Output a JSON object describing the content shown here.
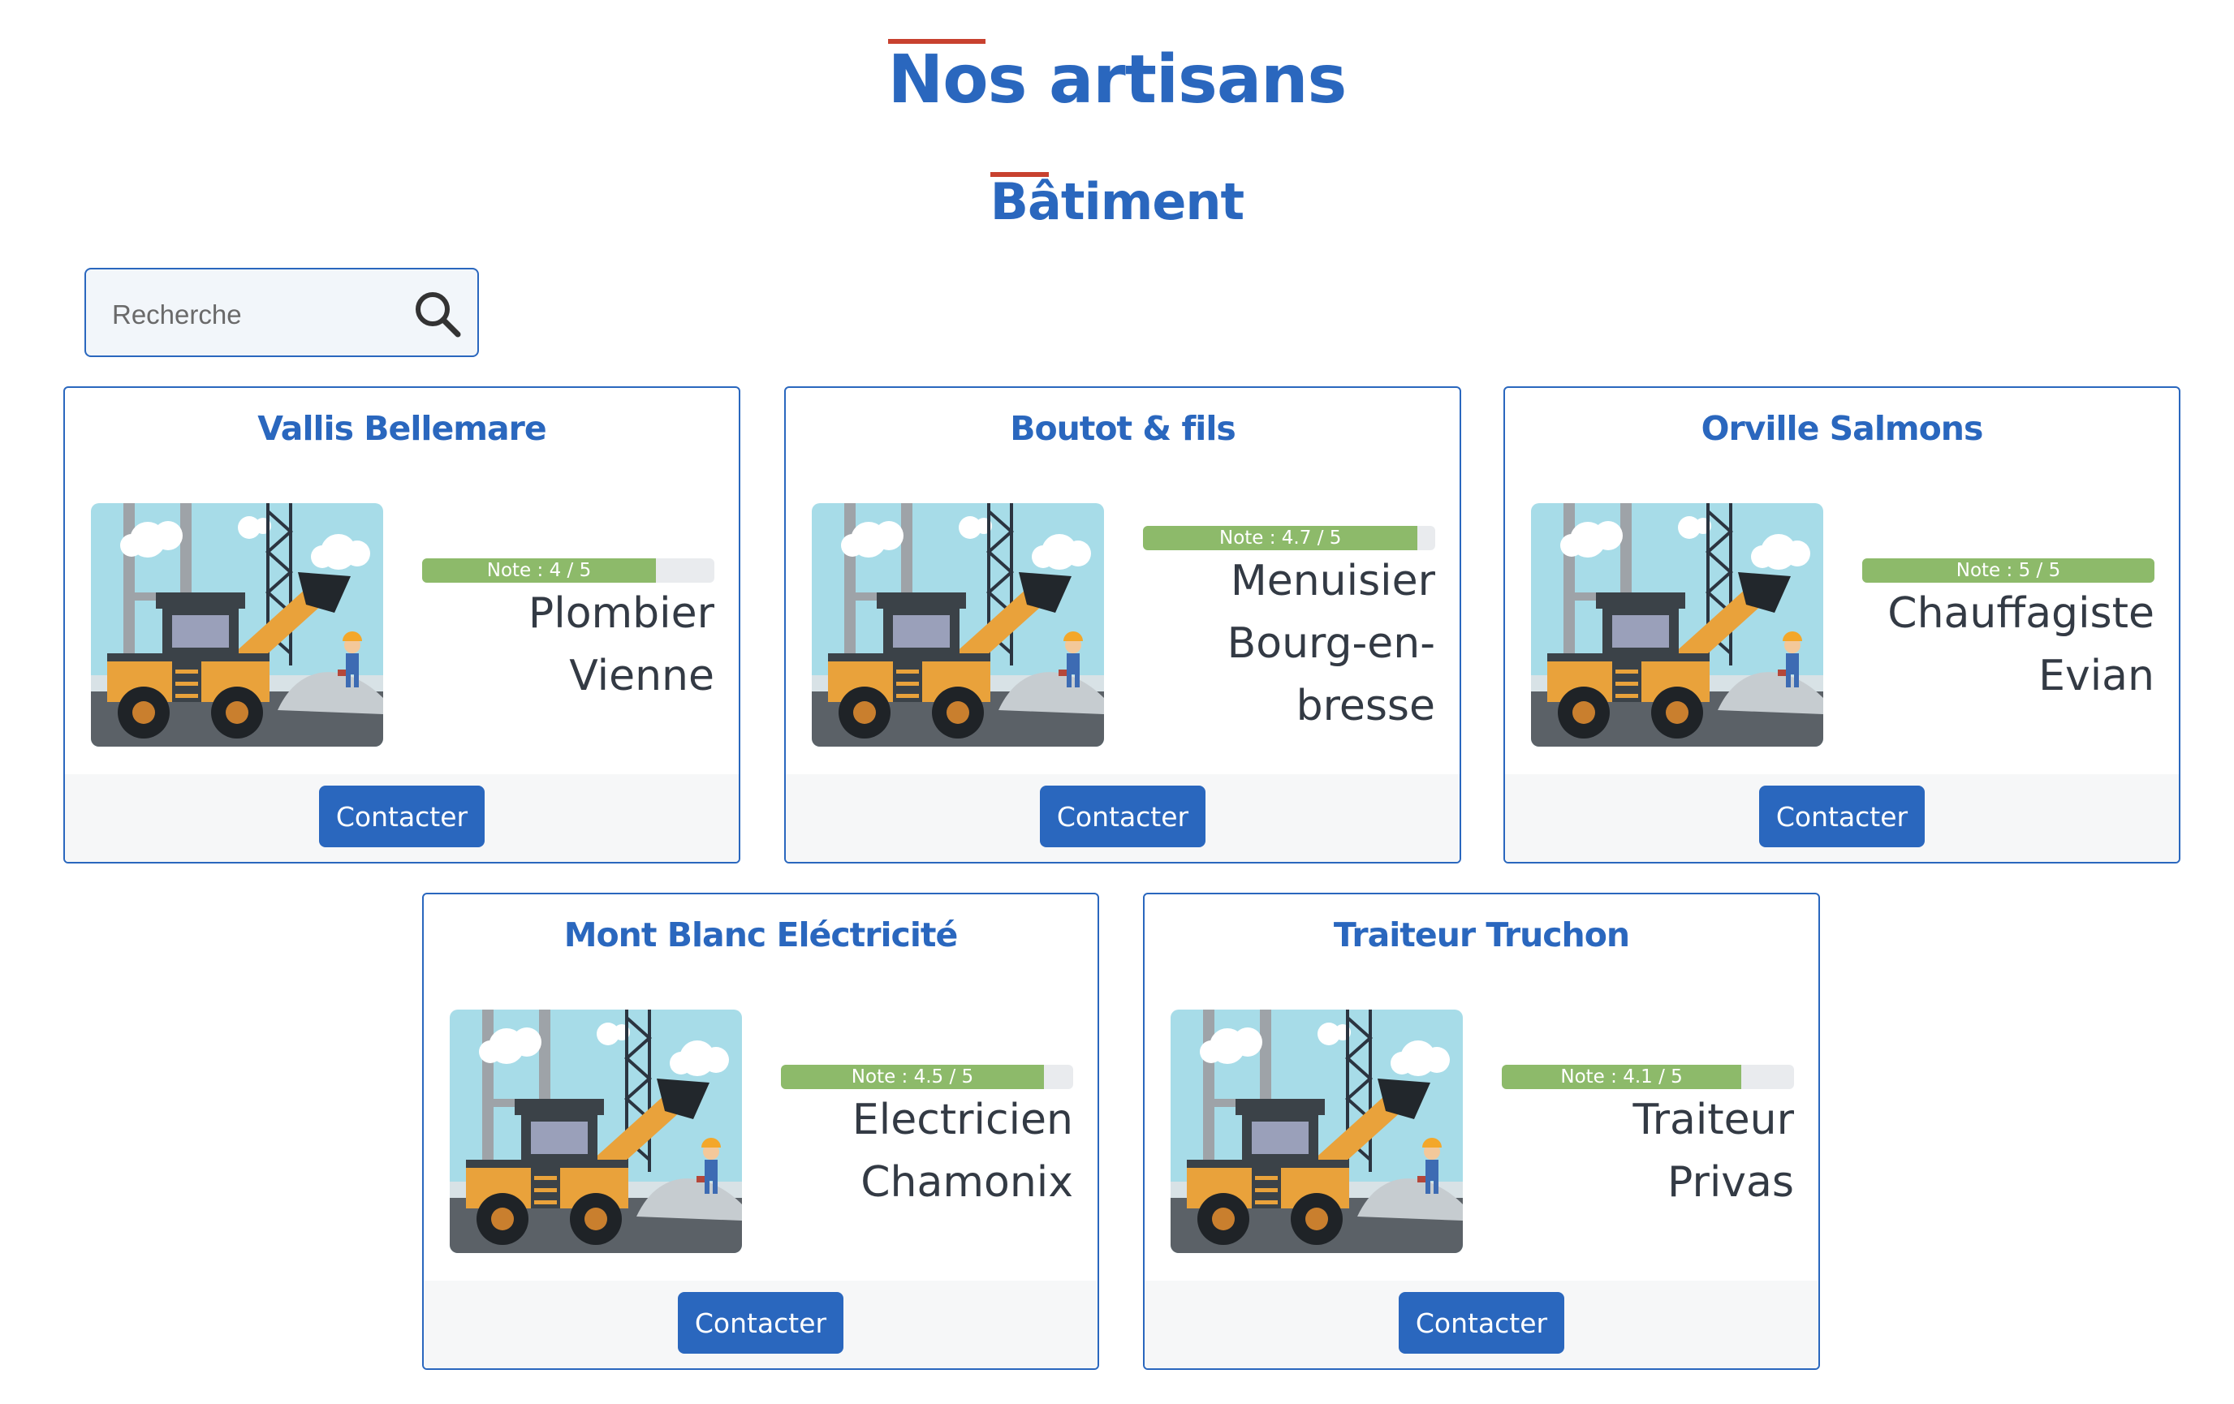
{
  "page": {
    "title": "Nos artisans",
    "subtitle": "Bâtiment"
  },
  "search": {
    "placeholder": "Recherche",
    "icon": "search-icon"
  },
  "colors": {
    "accent": "#2a67be",
    "heading_underline": "#c8412f",
    "rating_fill": "#8dba6a",
    "rating_track": "#e9ebee"
  },
  "cards": [
    {
      "name": "Vallis Bellemare",
      "rating_label": "Note : 4 / 5",
      "rating": 4,
      "rating_max": 5,
      "lines": [
        "Plombier",
        "Vienne"
      ],
      "button": "Contacter"
    },
    {
      "name": "Boutot & fils",
      "rating_label": "Note : 4.7 / 5",
      "rating": 4.7,
      "rating_max": 5,
      "lines": [
        "Menuisier",
        "Bourg-en-",
        "bresse"
      ],
      "button": "Contacter"
    },
    {
      "name": "Orville Salmons",
      "rating_label": "Note : 5 / 5",
      "rating": 5,
      "rating_max": 5,
      "lines": [
        "Chauffagiste",
        "Evian"
      ],
      "button": "Contacter"
    },
    {
      "name": "Mont Blanc Eléctricité",
      "rating_label": "Note : 4.5 / 5",
      "rating": 4.5,
      "rating_max": 5,
      "lines": [
        "Electricien",
        "Chamonix"
      ],
      "button": "Contacter"
    },
    {
      "name": "Traiteur Truchon",
      "rating_label": "Note : 4.1 / 5",
      "rating": 4.1,
      "rating_max": 5,
      "lines": [
        "Traiteur",
        "Privas"
      ],
      "button": "Contacter"
    }
  ]
}
